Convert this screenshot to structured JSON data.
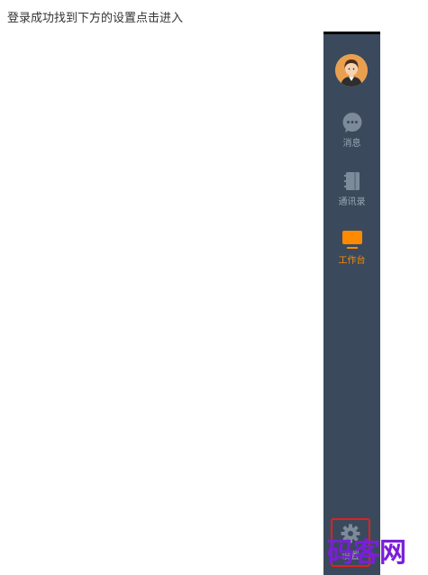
{
  "instruction": "登录成功找到下方的设置点击进入",
  "sidebar": {
    "items": [
      {
        "label": "消息",
        "icon": "chat-bubble-icon",
        "active": false
      },
      {
        "label": "通讯录",
        "icon": "address-book-icon",
        "active": false
      },
      {
        "label": "工作台",
        "icon": "monitor-icon",
        "active": true
      }
    ],
    "settings": {
      "label": "设置",
      "icon": "gear-icon",
      "highlighted": true
    }
  },
  "watermark": "码客网",
  "colors": {
    "sidebar_bg": "#3a4a5c",
    "icon_inactive": "#7d8a99",
    "label_inactive": "#9aa6b4",
    "active": "#ff8a00",
    "highlight_border": "#e02020",
    "watermark": "#7a1fd8",
    "avatar_bg": "#e8a050"
  }
}
